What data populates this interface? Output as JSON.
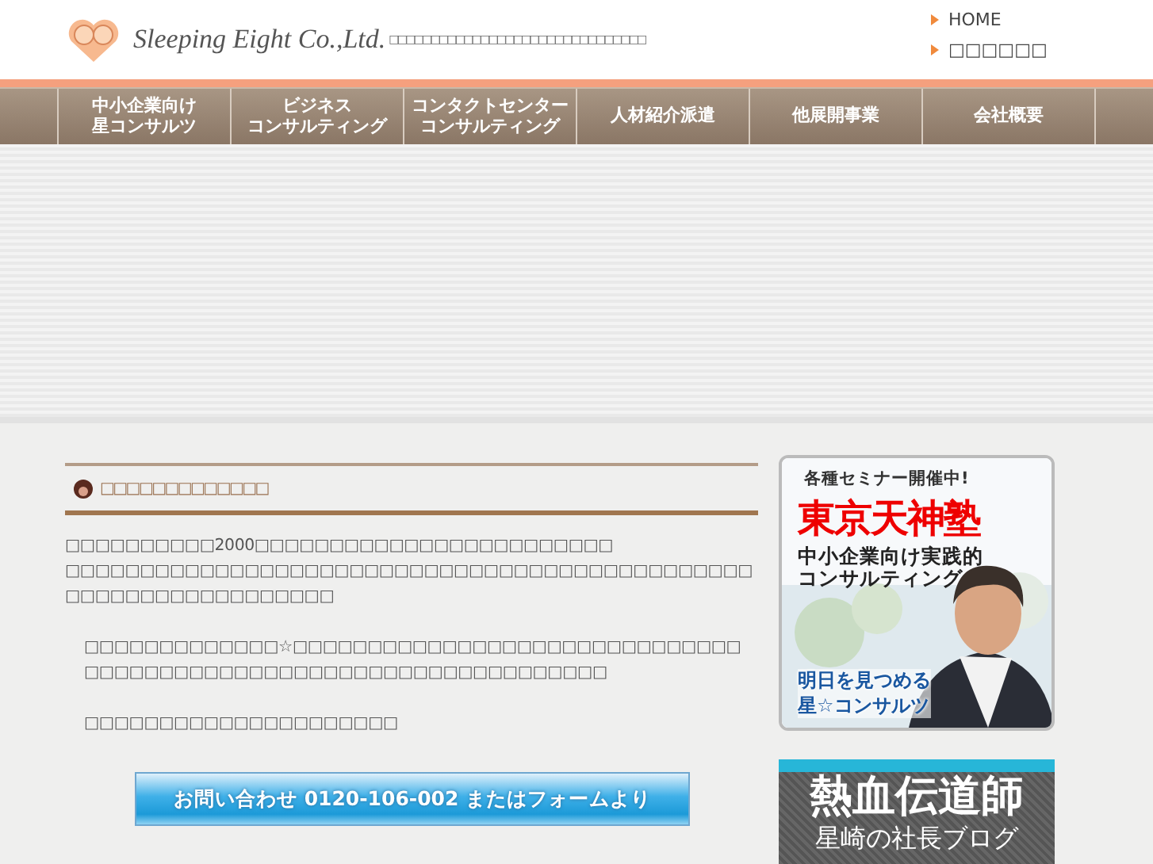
{
  "header": {
    "company": "Sleeping Eight Co.,Ltd.",
    "tagline": "□□□□□□□□□□□□□□□□□□□□□□□□□□□□□□□",
    "links": [
      "HOME",
      "□□□□□□"
    ]
  },
  "nav": [
    {
      "lines": [
        "中小企業向け",
        "星コンサルツ"
      ]
    },
    {
      "lines": [
        "ビジネス",
        "コンサルティング"
      ]
    },
    {
      "lines": [
        "コンタクトセンター",
        "コンサルティング"
      ]
    },
    {
      "lines": [
        "人材紹介派遣"
      ]
    },
    {
      "lines": [
        "他展開事業"
      ]
    },
    {
      "lines": [
        "会社概要"
      ]
    }
  ],
  "article": {
    "heading": "□□□□□□□□□□□□□",
    "paragraphs": [
      {
        "indent": false,
        "lines": [
          "□□□□□□□□□□2000□□□□□□□□□□□□□□□□□□□□□□□□",
          "□□□□□□□□□□□□□□□□□□□□□□□□□□□□□□□□□□□□□□□□□□□□□□",
          "□□□□□□□□□□□□□□□□□□"
        ]
      },
      {
        "indent": true,
        "lines": [
          "□□□□□□□□□□□□□☆□□□□□□□□□□□□□□□□□□□□□□□□□□□□□□",
          "□□□□□□□□□□□□□□□□□□□□□□□□□□□□□□□□□□□"
        ]
      },
      {
        "indent": true,
        "lines": [
          "□□□□□□□□□□□□□□□□□□□□□"
        ]
      }
    ],
    "contact_button": "お問い合わせ 0120-106-002 またはフォームより"
  },
  "sidebar": {
    "seminar_banner": {
      "kind": "picture",
      "eyebrow": "各種セミナー開催中!",
      "title": "東京天神塾",
      "subtitle": [
        "中小企業向け実践的",
        "コンサルティング"
      ],
      "tagline": [
        "明日を見つめる",
        "星☆コンサルツ"
      ]
    },
    "blog_banner": {
      "title": "熱血伝道師",
      "subtitle": "星崎の社長ブログ"
    }
  }
}
